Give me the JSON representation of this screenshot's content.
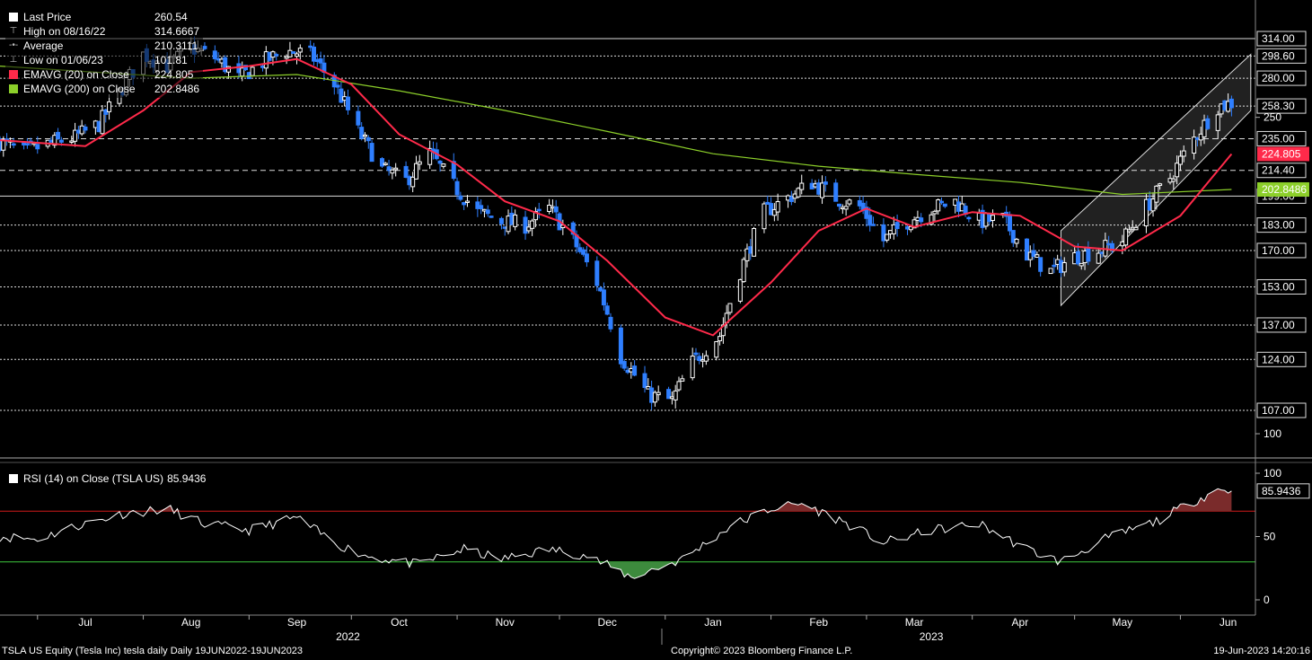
{
  "legend": {
    "last_price_label": "Last Price",
    "last_price_value": "260.54",
    "high_label": "High on 08/16/22",
    "high_value": "314.6667",
    "average_label": "Average",
    "average_value": "210.3111",
    "low_label": "Low on 01/06/23",
    "low_value": "101.81",
    "ema20_label": "EMAVG (20)  on Close",
    "ema20_value": "224.805",
    "ema200_label": "EMAVG (200)  on Close",
    "ema200_value": "202.8486"
  },
  "rsi_legend": {
    "label": "RSI (14)  on Close (TSLA US)",
    "value": "85.9436"
  },
  "footer": {
    "left": "TSLA US Equity (Tesla Inc) tesla daily  Daily 19JUN2022-19JUN2023",
    "center": "Copyright© 2023 Bloomberg Finance L.P.",
    "right": "19-Jun-2023 14:20:16"
  },
  "colors": {
    "background": "#000000",
    "up_candle": "#ffffff",
    "down_candle": "#2f7fff",
    "ema20": "#ff2a4a",
    "ema200": "#8ccf2a",
    "rsi_line": "#ffffff",
    "rsi_overbought": "#d01a1a",
    "rsi_oversold": "#3ec93e",
    "rsi_ob_fill": "#7a2b2b",
    "rsi_os_fill": "#3d8a3d",
    "channel": "#ffffff"
  },
  "chart_data": [
    {
      "type": "candlestick",
      "title": "TSLA US Equity (Tesla Inc) tesla daily",
      "x_range": [
        "2022-06-20",
        "2023-06-16"
      ],
      "x_month_labels": [
        "Jul",
        "Aug",
        "Sep",
        "Oct",
        "Nov",
        "Dec",
        "Jan",
        "Feb",
        "Mar",
        "Apr",
        "May",
        "Jun"
      ],
      "x_year_labels": [
        "2022",
        "2023"
      ],
      "y_tick_labels": [
        100,
        250
      ],
      "y_range": [
        93,
        345
      ],
      "reference_lines": [
        {
          "level": 314.0,
          "label": "314.00",
          "style": "solid"
        },
        {
          "level": 298.6,
          "label": "298.60",
          "style": "dotted"
        },
        {
          "level": 280.0,
          "label": "280.00",
          "style": "dotted"
        },
        {
          "level": 258.3,
          "label": "258.30",
          "style": "dotted"
        },
        {
          "level": 235.0,
          "label": "235.00",
          "style": "dashed"
        },
        {
          "level": 214.4,
          "label": "214.40",
          "style": "dashed"
        },
        {
          "level": 199.0,
          "label": "199.00",
          "style": "solid"
        },
        {
          "level": 183.0,
          "label": "183.00",
          "style": "dotted"
        },
        {
          "level": 170.0,
          "label": "170.00",
          "style": "dotted"
        },
        {
          "level": 153.0,
          "label": "153.00",
          "style": "dotted"
        },
        {
          "level": 137.0,
          "label": "137.00",
          "style": "dotted"
        },
        {
          "level": 124.0,
          "label": "124.00",
          "style": "dotted"
        },
        {
          "level": 107.0,
          "label": "107.00",
          "style": "dotted"
        }
      ],
      "current_value_tags": [
        {
          "value": 224.805,
          "label": "224.805",
          "color": "#ff2a4a"
        },
        {
          "value": 202.8486,
          "label": "202.8486",
          "color": "#8ccf2a"
        }
      ],
      "close_series_points": [
        [
          "2022-06-20",
          233
        ],
        [
          "2022-06-27",
          226
        ],
        [
          "2022-07-05",
          232
        ],
        [
          "2022-07-12",
          236
        ],
        [
          "2022-07-19",
          245
        ],
        [
          "2022-07-25",
          268
        ],
        [
          "2022-08-01",
          300
        ],
        [
          "2022-08-08",
          290
        ],
        [
          "2022-08-15",
          306
        ],
        [
          "2022-08-22",
          297
        ],
        [
          "2022-08-29",
          280
        ],
        [
          "2022-09-06",
          295
        ],
        [
          "2022-09-12",
          303
        ],
        [
          "2022-09-19",
          300
        ],
        [
          "2022-09-26",
          275
        ],
        [
          "2022-10-03",
          240
        ],
        [
          "2022-10-10",
          215
        ],
        [
          "2022-10-17",
          208
        ],
        [
          "2022-10-24",
          225
        ],
        [
          "2022-10-31",
          205
        ],
        [
          "2022-11-07",
          190
        ],
        [
          "2022-11-14",
          185
        ],
        [
          "2022-11-21",
          183
        ],
        [
          "2022-11-28",
          192
        ],
        [
          "2022-12-05",
          175
        ],
        [
          "2022-12-12",
          155
        ],
        [
          "2022-12-19",
          125
        ],
        [
          "2022-12-27",
          112
        ],
        [
          "2023-01-03",
          110
        ],
        [
          "2023-01-09",
          123
        ],
        [
          "2023-01-17",
          133
        ],
        [
          "2023-01-23",
          160
        ],
        [
          "2023-01-30",
          190
        ],
        [
          "2023-02-06",
          198
        ],
        [
          "2023-02-13",
          207
        ],
        [
          "2023-02-21",
          197
        ],
        [
          "2023-02-27",
          193
        ],
        [
          "2023-03-06",
          175
        ],
        [
          "2023-03-13",
          185
        ],
        [
          "2023-03-20",
          192
        ],
        [
          "2023-03-27",
          196
        ],
        [
          "2023-04-03",
          185
        ],
        [
          "2023-04-10",
          186
        ],
        [
          "2023-04-17",
          168
        ],
        [
          "2023-04-24",
          160
        ],
        [
          "2023-05-01",
          167
        ],
        [
          "2023-05-08",
          170
        ],
        [
          "2023-05-15",
          175
        ],
        [
          "2023-05-22",
          193
        ],
        [
          "2023-05-29",
          210
        ],
        [
          "2023-06-05",
          235
        ],
        [
          "2023-06-12",
          258
        ],
        [
          "2023-06-16",
          260.54
        ]
      ],
      "ema20_points": [
        [
          "2022-06-20",
          234
        ],
        [
          "2022-07-15",
          230
        ],
        [
          "2022-08-01",
          255
        ],
        [
          "2022-08-15",
          285
        ],
        [
          "2022-09-01",
          290
        ],
        [
          "2022-09-15",
          296
        ],
        [
          "2022-10-01",
          275
        ],
        [
          "2022-10-15",
          238
        ],
        [
          "2022-11-01",
          218
        ],
        [
          "2022-11-15",
          196
        ],
        [
          "2022-12-01",
          185
        ],
        [
          "2022-12-15",
          165
        ],
        [
          "2023-01-01",
          140
        ],
        [
          "2023-01-15",
          133
        ],
        [
          "2023-02-01",
          155
        ],
        [
          "2023-02-15",
          180
        ],
        [
          "2023-03-01",
          192
        ],
        [
          "2023-03-15",
          182
        ],
        [
          "2023-04-01",
          190
        ],
        [
          "2023-04-15",
          188
        ],
        [
          "2023-05-01",
          172
        ],
        [
          "2023-05-15",
          170
        ],
        [
          "2023-06-01",
          188
        ],
        [
          "2023-06-16",
          224.805
        ]
      ],
      "ema200_points": [
        [
          "2022-06-20",
          290
        ],
        [
          "2022-08-15",
          280
        ],
        [
          "2022-09-15",
          283
        ],
        [
          "2022-10-15",
          270
        ],
        [
          "2022-11-15",
          255
        ],
        [
          "2022-12-15",
          240
        ],
        [
          "2023-01-15",
          225
        ],
        [
          "2023-02-15",
          217
        ],
        [
          "2023-03-15",
          212
        ],
        [
          "2023-04-15",
          207
        ],
        [
          "2023-05-15",
          200
        ],
        [
          "2023-06-16",
          202.8486
        ]
      ],
      "trend_channel": {
        "start": "2023-04-27",
        "end": "2023-06-19",
        "lower": [
          145,
          255
        ],
        "upper": [
          180,
          300
        ]
      }
    },
    {
      "type": "line",
      "title": "RSI (14)  on Close (TSLA US)",
      "y_range": [
        0,
        100
      ],
      "y_tick_labels": [
        0,
        50,
        100
      ],
      "overbought": 70,
      "oversold": 30,
      "last_value": 85.9436,
      "points": [
        [
          "2022-06-20",
          50
        ],
        [
          "2022-07-01",
          48
        ],
        [
          "2022-07-12",
          58
        ],
        [
          "2022-07-26",
          68
        ],
        [
          "2022-08-08",
          72
        ],
        [
          "2022-08-19",
          60
        ],
        [
          "2022-09-01",
          55
        ],
        [
          "2022-09-15",
          65
        ],
        [
          "2022-09-26",
          45
        ],
        [
          "2022-10-05",
          35
        ],
        [
          "2022-10-20",
          28
        ],
        [
          "2022-11-03",
          40
        ],
        [
          "2022-11-14",
          32
        ],
        [
          "2022-11-28",
          40
        ],
        [
          "2022-12-09",
          35
        ],
        [
          "2022-12-22",
          18
        ],
        [
          "2023-01-06",
          32
        ],
        [
          "2023-01-20",
          58
        ],
        [
          "2023-02-01",
          72
        ],
        [
          "2023-02-10",
          76
        ],
        [
          "2023-02-22",
          62
        ],
        [
          "2023-03-06",
          45
        ],
        [
          "2023-03-20",
          55
        ],
        [
          "2023-04-03",
          60
        ],
        [
          "2023-04-17",
          40
        ],
        [
          "2023-04-27",
          30
        ],
        [
          "2023-05-10",
          48
        ],
        [
          "2023-05-25",
          62
        ],
        [
          "2023-06-05",
          78
        ],
        [
          "2023-06-12",
          87
        ],
        [
          "2023-06-16",
          85.9436
        ]
      ]
    }
  ]
}
